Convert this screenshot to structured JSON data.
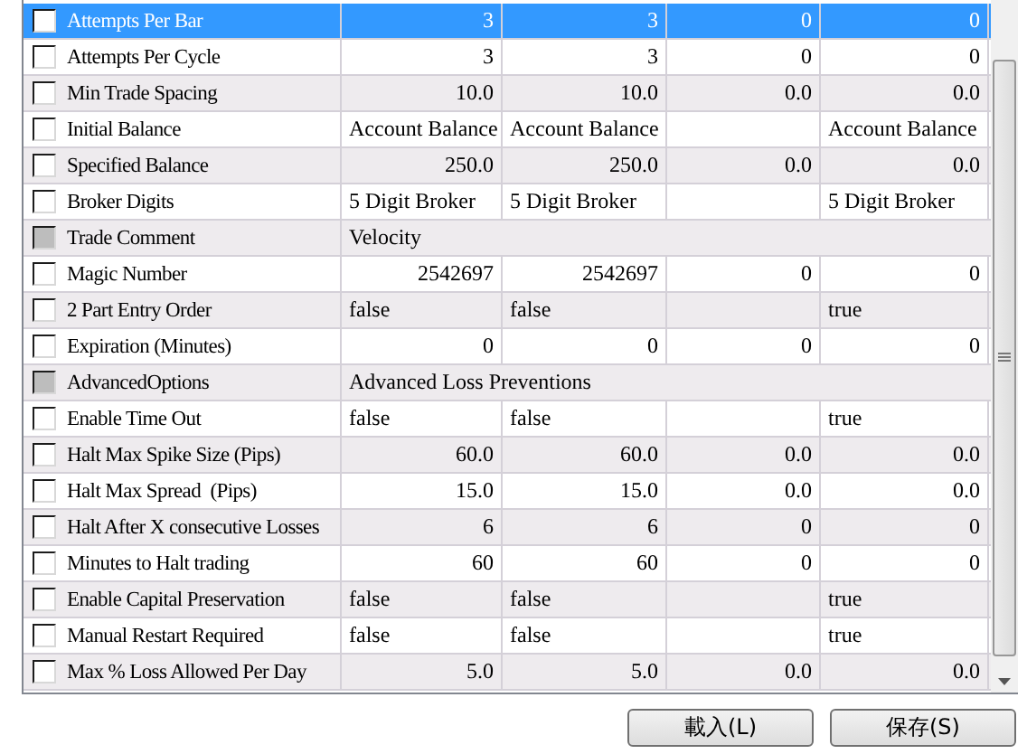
{
  "rows": [
    {
      "kind": "number",
      "name": "Attempts Per Bar",
      "checked": false,
      "selected": true,
      "column_1": "3",
      "column_2": "3",
      "column_3": "0",
      "column_4": "0"
    },
    {
      "kind": "number",
      "name": "Attempts Per Cycle",
      "checked": false,
      "selected": false,
      "column_1": "3",
      "column_2": "3",
      "column_3": "0",
      "column_4": "0"
    },
    {
      "kind": "number",
      "name": "Min Trade Spacing",
      "checked": false,
      "selected": false,
      "column_1": "10.0",
      "column_2": "10.0",
      "column_3": "0.0",
      "column_4": "0.0"
    },
    {
      "kind": "text",
      "name": "Initial Balance",
      "checked": false,
      "selected": false,
      "column_1": "Account Balance",
      "column_2": "Account Balance",
      "column_4": "Account Balance"
    },
    {
      "kind": "number",
      "name": "Specified Balance",
      "checked": false,
      "selected": false,
      "column_1": "250.0",
      "column_2": "250.0",
      "column_3": "0.0",
      "column_4": "0.0"
    },
    {
      "kind": "text",
      "name": "Broker Digits",
      "checked": false,
      "selected": false,
      "column_1": "5 Digit Broker",
      "column_2": "5 Digit Broker",
      "column_4": "5 Digit Broker"
    },
    {
      "kind": "group",
      "name": "Trade Comment",
      "checked": false,
      "selected": false,
      "value": "Velocity"
    },
    {
      "kind": "number",
      "name": "Magic Number",
      "checked": false,
      "selected": false,
      "column_1": "2542697",
      "column_2": "2542697",
      "column_3": "0",
      "column_4": "0"
    },
    {
      "kind": "text",
      "name": "2 Part Entry Order",
      "checked": false,
      "selected": false,
      "column_1": "false",
      "column_2": "false",
      "column_4": "true"
    },
    {
      "kind": "number",
      "name": "Expiration (Minutes)",
      "checked": false,
      "selected": false,
      "column_1": "0",
      "column_2": "0",
      "column_3": "0",
      "column_4": "0"
    },
    {
      "kind": "group",
      "name": "AdvancedOptions",
      "checked": false,
      "selected": false,
      "value": "Advanced Loss Preventions"
    },
    {
      "kind": "text",
      "name": "Enable Time Out",
      "checked": false,
      "selected": false,
      "column_1": "false",
      "column_2": "false",
      "column_4": "true"
    },
    {
      "kind": "number",
      "name": "Halt Max Spike Size (Pips)",
      "checked": false,
      "selected": false,
      "column_1": "60.0",
      "column_2": "60.0",
      "column_3": "0.0",
      "column_4": "0.0"
    },
    {
      "kind": "number",
      "name": "Halt Max Spread  (Pips)",
      "checked": false,
      "selected": false,
      "column_1": "15.0",
      "column_2": "15.0",
      "column_3": "0.0",
      "column_4": "0.0"
    },
    {
      "kind": "number",
      "name": "Halt After X consecutive Losses",
      "checked": false,
      "selected": false,
      "column_1": "6",
      "column_2": "6",
      "column_3": "0",
      "column_4": "0"
    },
    {
      "kind": "number",
      "name": "Minutes to Halt trading",
      "checked": false,
      "selected": false,
      "column_1": "60",
      "column_2": "60",
      "column_3": "0",
      "column_4": "0"
    },
    {
      "kind": "text",
      "name": "Enable Capital Preservation",
      "checked": false,
      "selected": false,
      "column_1": "false",
      "column_2": "false",
      "column_4": "true"
    },
    {
      "kind": "text",
      "name": "Manual Restart Required",
      "checked": false,
      "selected": false,
      "column_1": "false",
      "column_2": "false",
      "column_4": "true"
    },
    {
      "kind": "number",
      "name": "Max % Loss Allowed Per Day",
      "checked": false,
      "selected": false,
      "column_1": "5.0",
      "column_2": "5.0",
      "column_3": "0.0",
      "column_4": "0.0"
    }
  ],
  "buttons": [
    {
      "label": "載入(L)"
    },
    {
      "label": "保存(S)"
    }
  ]
}
